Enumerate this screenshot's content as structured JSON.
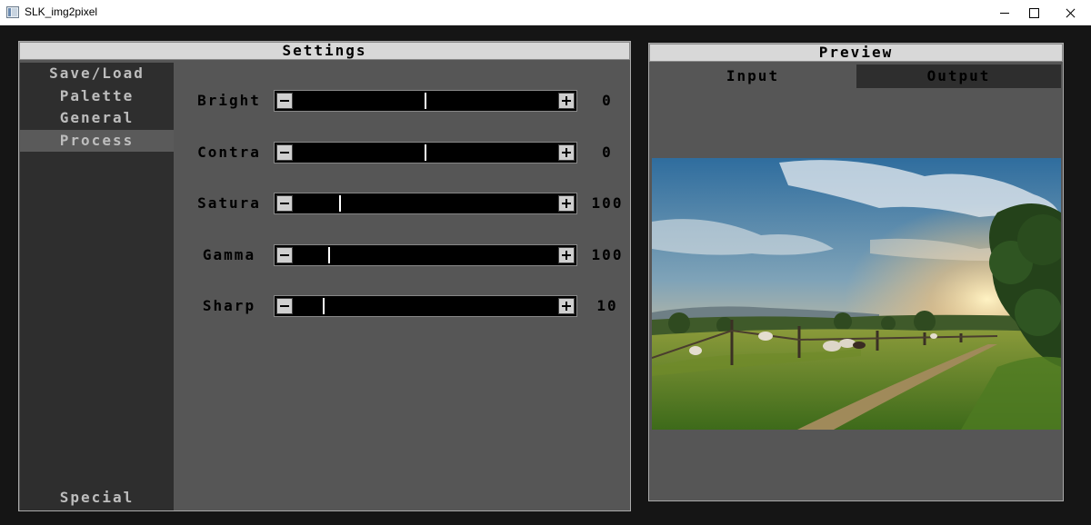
{
  "window": {
    "title": "SLK_img2pixel"
  },
  "settings": {
    "header": "Settings",
    "sidebar": {
      "items": [
        {
          "label": "Save/Load",
          "active": false
        },
        {
          "label": "Palette",
          "active": false
        },
        {
          "label": "General",
          "active": false
        },
        {
          "label": "Process",
          "active": true
        }
      ],
      "bottom_item": "Special"
    },
    "sliders": [
      {
        "label": "Bright",
        "value": "0",
        "level": 0.5
      },
      {
        "label": "Contra",
        "value": "0",
        "level": 0.5
      },
      {
        "label": "Satura",
        "value": "100",
        "level": 0.17
      },
      {
        "label": "Gamma",
        "value": "100",
        "level": 0.13
      },
      {
        "label": "Sharp",
        "value": "10",
        "level": 0.11
      }
    ]
  },
  "preview": {
    "header": "Preview",
    "tabs": [
      {
        "label": "Input",
        "active": true
      },
      {
        "label": "Output",
        "active": false
      }
    ],
    "image": "landscape-photo"
  },
  "colors": {
    "panel_bg": "#565656",
    "sidebar_bg": "#2e2e2e",
    "header_bg": "#d8d8d8",
    "track_bg": "#000000"
  }
}
